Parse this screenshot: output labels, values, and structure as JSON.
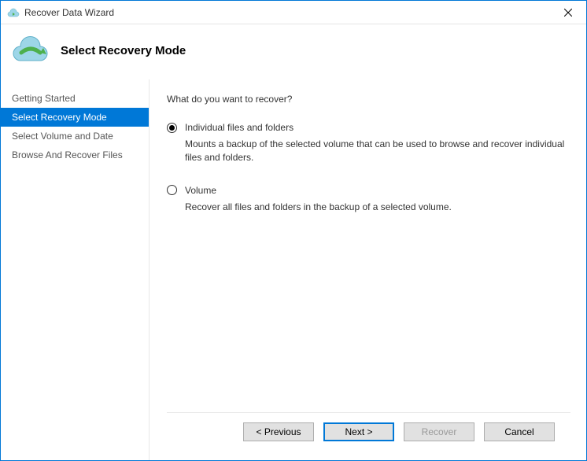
{
  "window": {
    "title": "Recover Data Wizard"
  },
  "header": {
    "title": "Select Recovery Mode"
  },
  "sidebar": {
    "items": [
      {
        "label": "Getting Started",
        "active": false
      },
      {
        "label": "Select Recovery Mode",
        "active": true
      },
      {
        "label": "Select Volume and Date",
        "active": false
      },
      {
        "label": "Browse And Recover Files",
        "active": false
      }
    ]
  },
  "main": {
    "prompt": "What do you want to recover?",
    "options": [
      {
        "label": "Individual files and folders",
        "description": "Mounts a backup of the selected volume that can be used to browse and recover individual files and folders.",
        "selected": true
      },
      {
        "label": "Volume",
        "description": "Recover all files and folders in the backup of a selected volume.",
        "selected": false
      }
    ]
  },
  "footer": {
    "previous": "<  Previous",
    "next": "Next  >",
    "recover": "Recover",
    "cancel": "Cancel"
  }
}
